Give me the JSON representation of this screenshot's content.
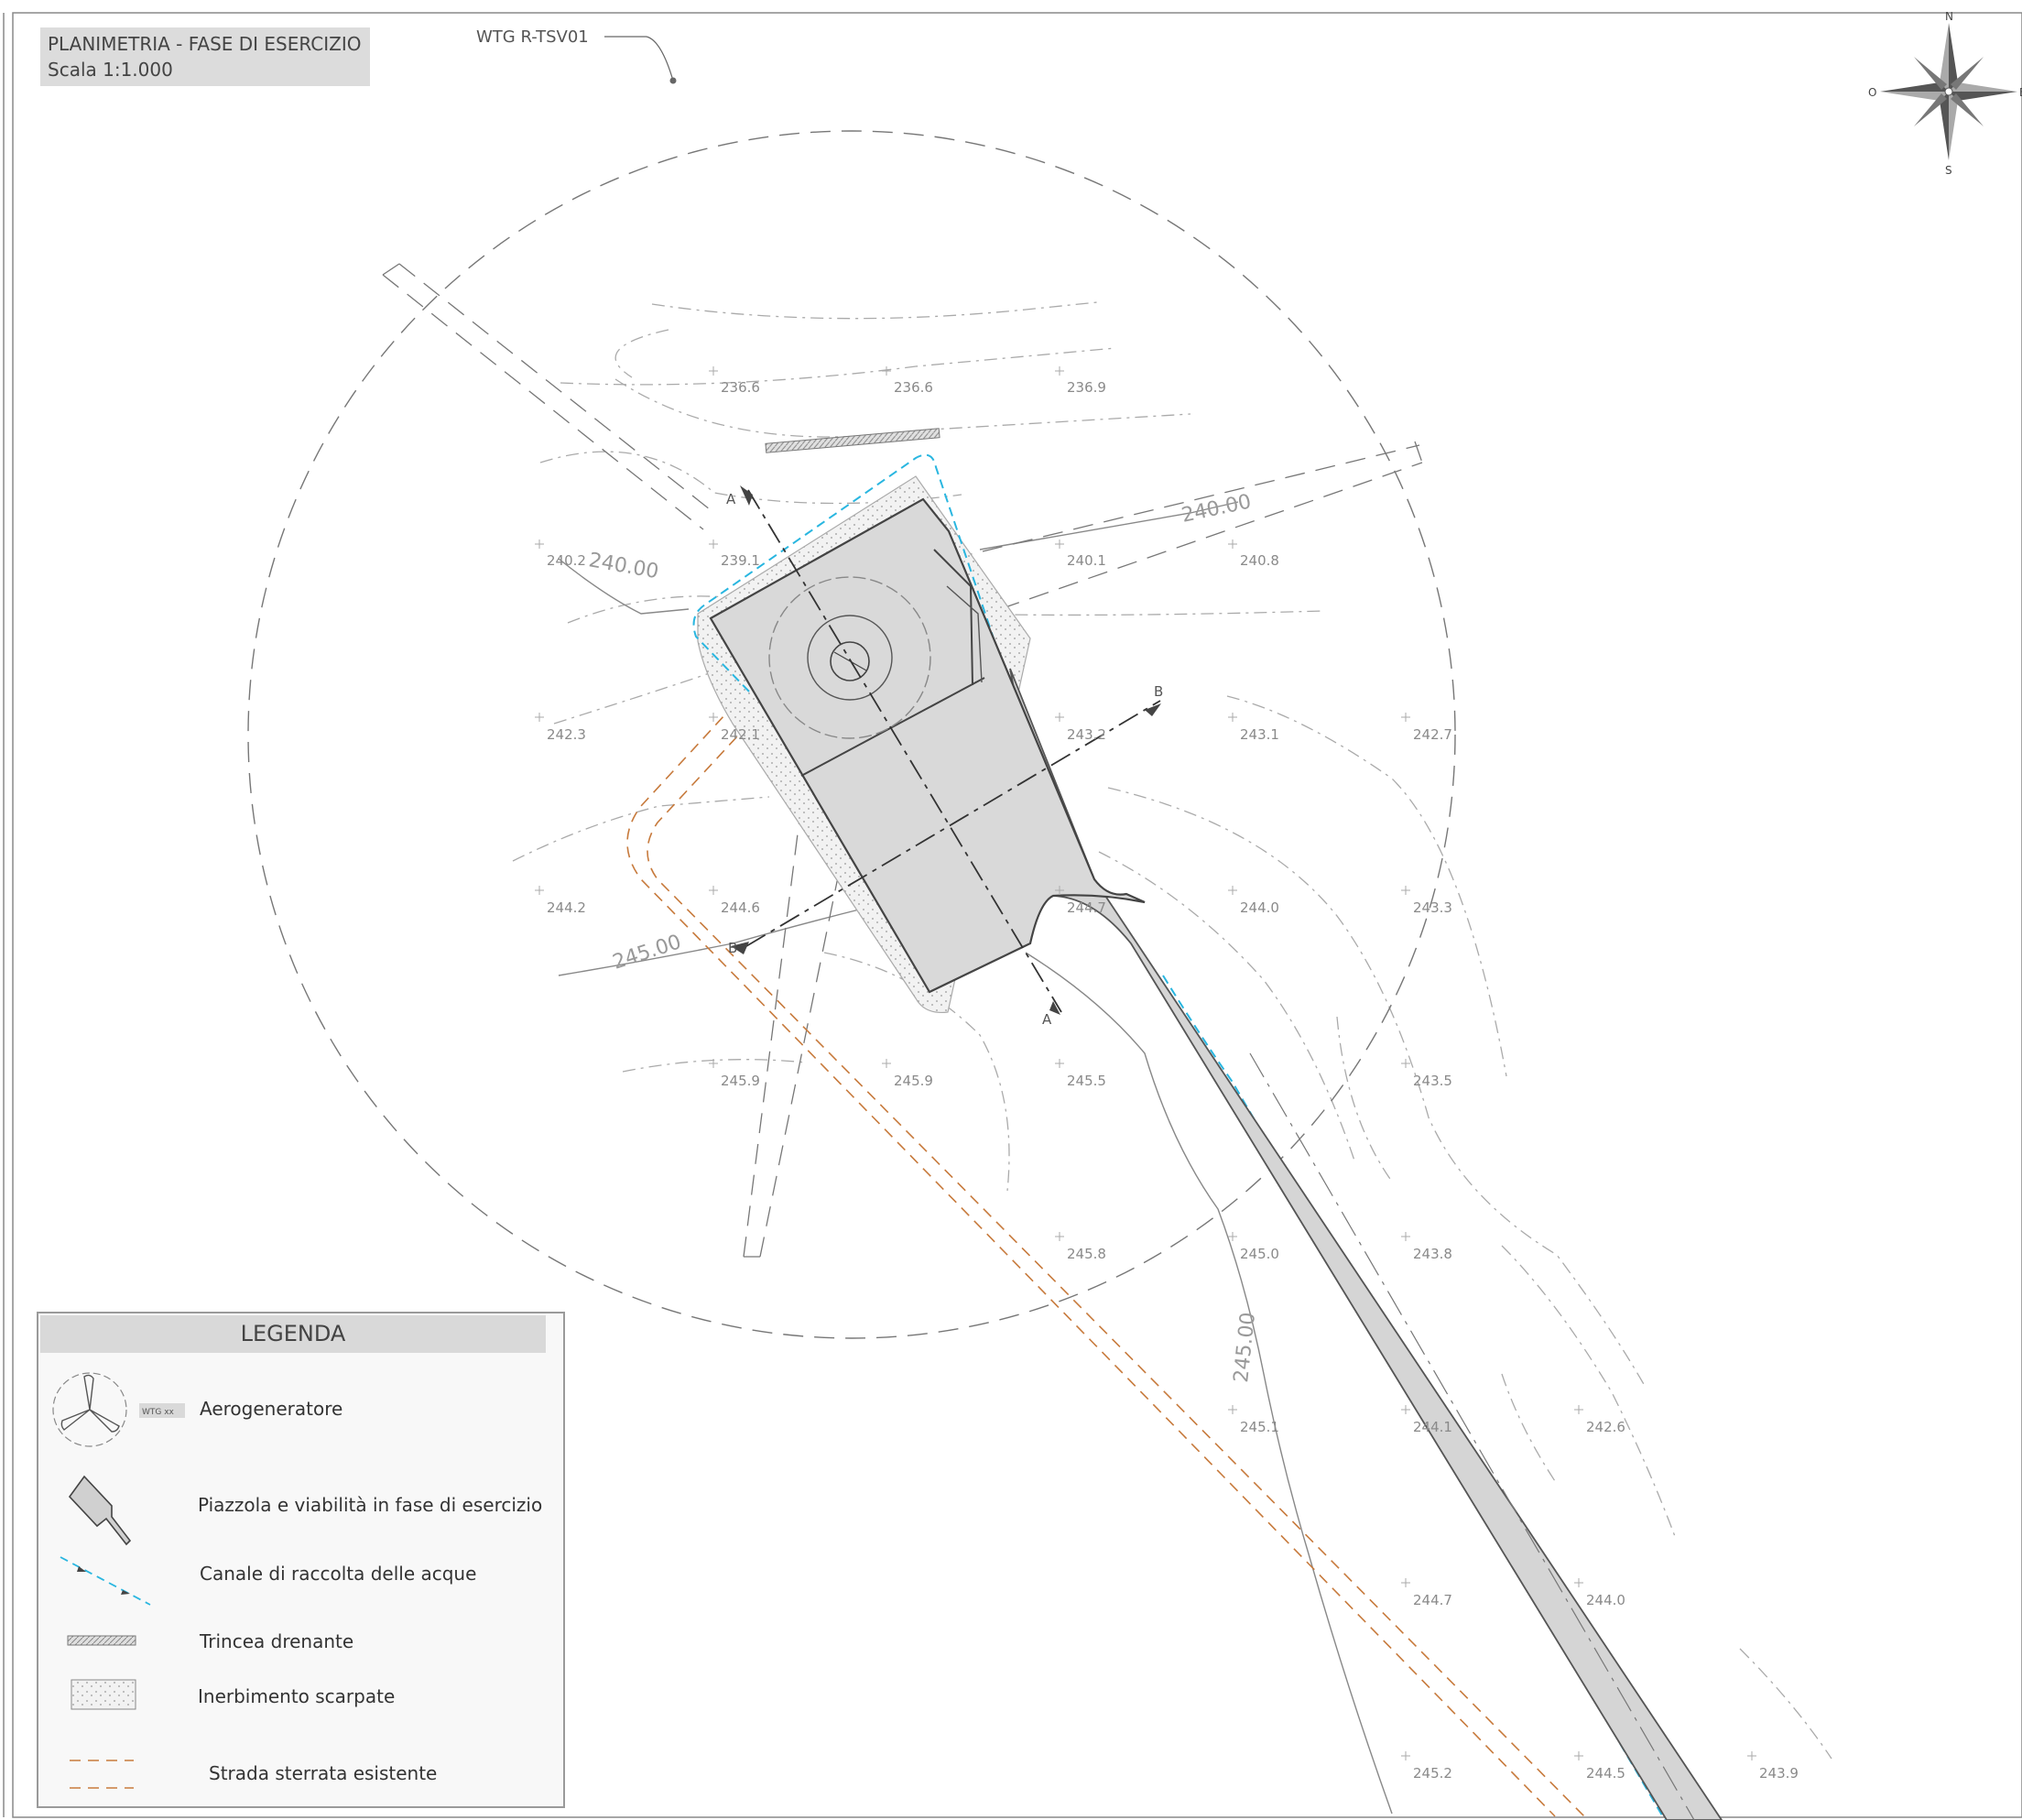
{
  "title": {
    "line1": "PLANIMETRIA - FASE DI ESERCIZIO",
    "line2": "Scala 1:1.000"
  },
  "turbine_label": "WTG R-TSV01",
  "compass": {
    "n": "N",
    "s": "S",
    "e": "E",
    "o": "O"
  },
  "sections": {
    "a": "A",
    "b": "B"
  },
  "contours": {
    "c240a": "240.00",
    "c240b": "240.00",
    "c245a": "245.00",
    "c245b": "245.00"
  },
  "spot_heights": [
    "236.6",
    "236.6",
    "236.9",
    "240.2",
    "239.1",
    "240.1",
    "240.8",
    "242.3",
    "242.1",
    "243.2",
    "243.1",
    "242.7",
    "244.2",
    "244.6",
    "244.7",
    "244.0",
    "243.3",
    "245.9",
    "245.9",
    "245.5",
    "243.5",
    "245.8",
    "245.0",
    "243.8",
    "245.1",
    "244.1",
    "242.6",
    "244.7",
    "244.0",
    "245.2",
    "244.5",
    "243.9"
  ],
  "legend": {
    "title": "LEGENDA",
    "wtg_tag": "WTG xx",
    "items": [
      "Aerogeneratore",
      "Piazzola e viabilità in fase di esercizio",
      "Canale di raccolta delle acque",
      "Trincea drenante",
      "Inerbimento scarpate",
      "Strada sterrata esistente"
    ]
  },
  "colors": {
    "pad": "#d9d9d9",
    "channel": "#29b6e0",
    "dirt_road": "#c77a3c",
    "line": "#555555"
  }
}
